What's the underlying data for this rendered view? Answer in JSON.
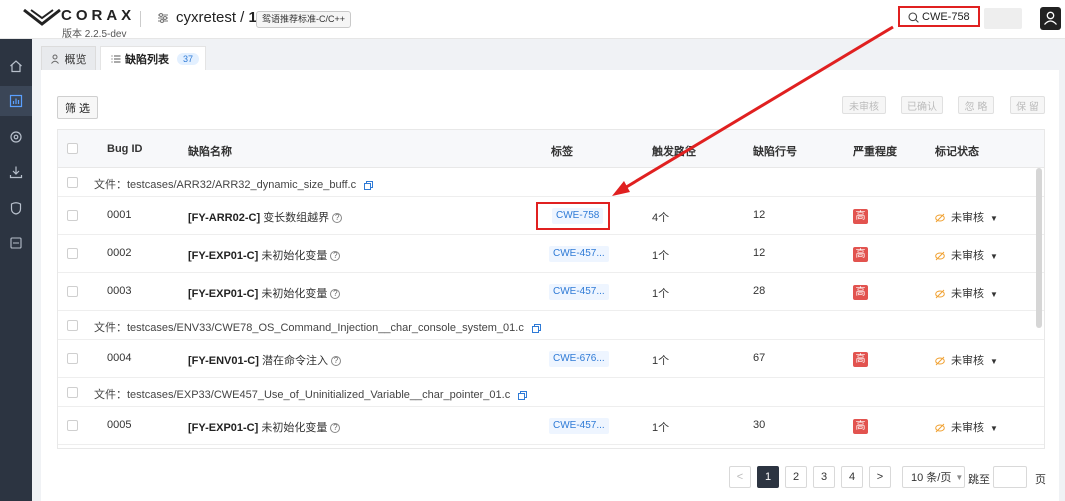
{
  "header": {
    "brand": "CORAX",
    "version": "版本 2.2.5-dev",
    "project_name": "cyxretest",
    "project_sep": " / ",
    "project_id": "1",
    "standard_tag": "鸳语推荐标准-C/C++",
    "search_value": "CWE-758"
  },
  "tabs": [
    {
      "label": "概览"
    },
    {
      "label": "缺陷列表",
      "count": "37"
    }
  ],
  "toolbar": {
    "filter_label": "筛 选",
    "actions": [
      "未审核",
      "已确认",
      "忽 略",
      "保 留"
    ]
  },
  "table": {
    "columns": [
      "Bug ID",
      "缺陷名称",
      "标签",
      "触发路径",
      "缺陷行号",
      "严重程度",
      "标记状态"
    ],
    "groups": [
      {
        "file_label": "文件：testcases/ARR32/ARR32_dynamic_size_buff.c",
        "rows": [
          {
            "id": "0001",
            "rule": "[FY-ARR02-C]",
            "name": "变长数组越界",
            "tag": "CWE-758",
            "paths": "4个",
            "line": "12",
            "severity": "高",
            "status": "未审核"
          },
          {
            "id": "0002",
            "rule": "[FY-EXP01-C]",
            "name": "未初始化变量",
            "tag": "CWE-457...",
            "paths": "1个",
            "line": "12",
            "severity": "高",
            "status": "未审核"
          },
          {
            "id": "0003",
            "rule": "[FY-EXP01-C]",
            "name": "未初始化变量",
            "tag": "CWE-457...",
            "paths": "1个",
            "line": "28",
            "severity": "高",
            "status": "未审核"
          }
        ]
      },
      {
        "file_label": "文件：testcases/ENV33/CWE78_OS_Command_Injection__char_console_system_01.c",
        "rows": [
          {
            "id": "0004",
            "rule": "[FY-ENV01-C]",
            "name": "潜在命令注入",
            "tag": "CWE-676...",
            "paths": "1个",
            "line": "67",
            "severity": "高",
            "status": "未审核"
          }
        ]
      },
      {
        "file_label": "文件：testcases/EXP33/CWE457_Use_of_Uninitialized_Variable__char_pointer_01.c",
        "rows": [
          {
            "id": "0005",
            "rule": "[FY-EXP01-C]",
            "name": "未初始化变量",
            "tag": "CWE-457...",
            "paths": "1个",
            "line": "30",
            "severity": "高",
            "status": "未审核"
          }
        ]
      }
    ]
  },
  "pagination": {
    "prev": "<",
    "pages": [
      "1",
      "2",
      "3",
      "4"
    ],
    "current": "1",
    "next": ">",
    "page_size": "10 条/页",
    "goto_label": "跳至",
    "page_unit": "页"
  },
  "colors": {
    "sidebar_bg": "#2c3441",
    "accent_blue": "#2e7ad6",
    "severity_high": "#e2534f",
    "annotation_red": "#e02020"
  }
}
